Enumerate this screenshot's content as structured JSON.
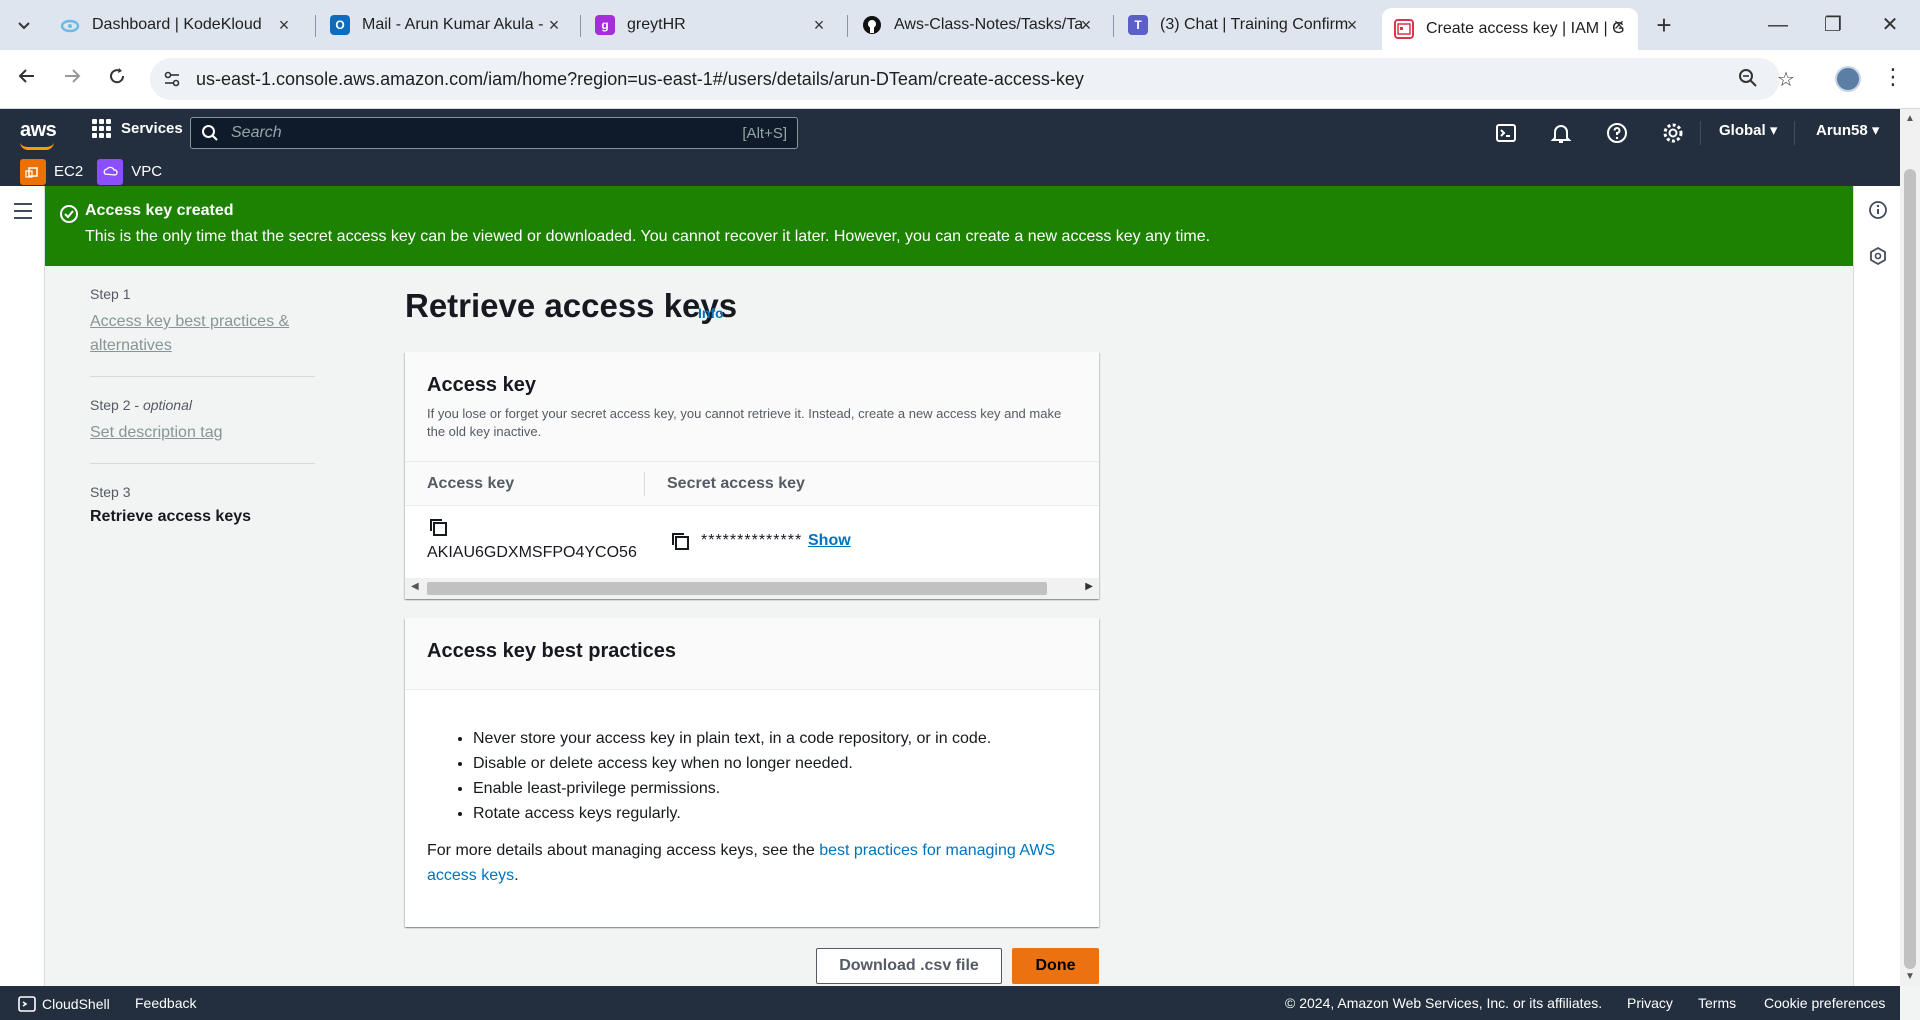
{
  "browser": {
    "tabs": [
      {
        "title": "Dashboard | KodeKloud",
        "favicon": "kodekloud-icon",
        "color": "#6bbbe6"
      },
      {
        "title": "Mail - Arun Kumar Akula -",
        "favicon": "outlook-icon",
        "color": "#0f6cbd"
      },
      {
        "title": "greytHR",
        "favicon": "greythr-icon",
        "color": "#a52ddc"
      },
      {
        "title": "Aws-Class-Notes/Tasks/Ta",
        "favicon": "github-icon",
        "color": "#111111"
      },
      {
        "title": "(3) Chat | Training Confirm",
        "favicon": "teams-icon",
        "color": "#5b5fc7"
      },
      {
        "title": "Create access key | IAM | G",
        "favicon": "iam-icon",
        "color": "#dd344c"
      }
    ],
    "url": "us-east-1.console.aws.amazon.com/iam/home?region=us-east-1#/users/details/arun-DTeam/create-access-key"
  },
  "aws_header": {
    "logo": "aws",
    "services_label": "Services",
    "search_placeholder": "Search",
    "search_shortcut": "[Alt+S]",
    "region": "Global ▾",
    "user": "Arun58 ▾",
    "favorites": [
      {
        "label": "EC2",
        "color": "#ed7100"
      },
      {
        "label": "VPC",
        "color": "#8c4fff"
      }
    ]
  },
  "flash": {
    "title": "Access key created",
    "message": "This is the only time that the secret access key can be viewed or downloaded. You cannot recover it later. However, you can create a new access key any time."
  },
  "steps": [
    {
      "number": "Step 1",
      "optional": "",
      "label": "Access key best practices & alternatives"
    },
    {
      "number": "Step 2",
      "optional": "optional",
      "label": "Set description tag"
    },
    {
      "number": "Step 3",
      "optional": "",
      "label": "Retrieve access keys"
    }
  ],
  "main": {
    "title": "Retrieve access keys",
    "info": "Info",
    "access_key_card": {
      "heading": "Access key",
      "description": "If you lose or forget your secret access key, you cannot retrieve it. Instead, create a new access key and make the old key inactive.",
      "col_access_key": "Access key",
      "col_secret": "Secret access key",
      "access_key_value": "AKIAU6GDXMSFPO4YCO56",
      "secret_value": "**************",
      "show_label": "Show"
    },
    "best_practices_card": {
      "heading": "Access key best practices",
      "items": [
        "Never store your access key in plain text, in a code repository, or in code.",
        "Disable or delete access key when no longer needed.",
        "Enable least-privilege permissions.",
        "Rotate access keys regularly."
      ],
      "more_prefix": "For more details about managing access keys, see the",
      "more_link": "best practices for managing AWS access keys",
      "more_suffix": "."
    },
    "download_label": "Download .csv file",
    "done_label": "Done"
  },
  "footer": {
    "cloudshell": "CloudShell",
    "feedback": "Feedback",
    "copyright": "© 2024, Amazon Web Services, Inc. or its affiliates.",
    "privacy": "Privacy",
    "terms": "Terms",
    "cookies": "Cookie preferences"
  }
}
